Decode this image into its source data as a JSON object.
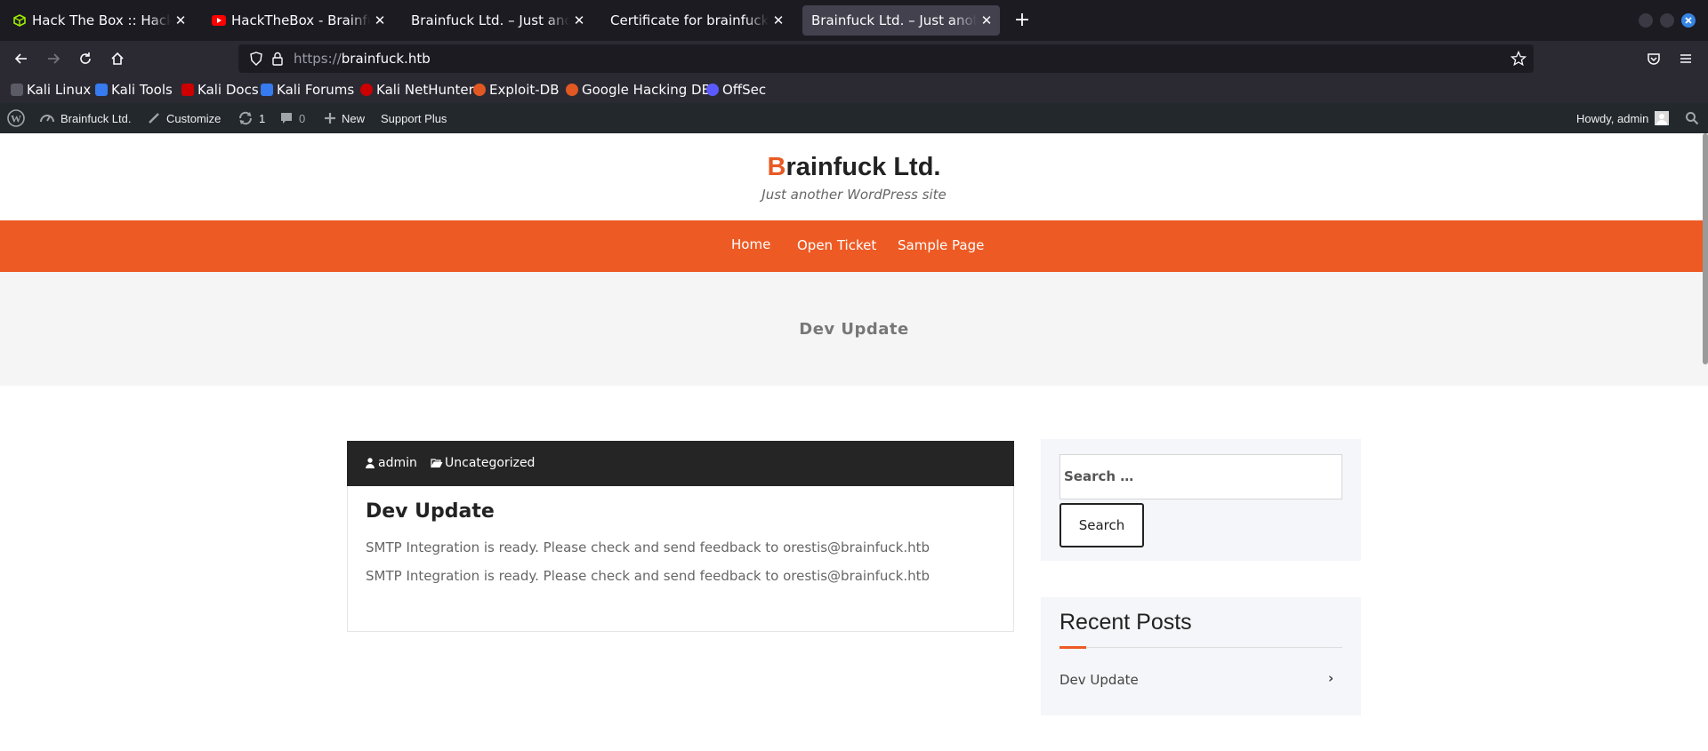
{
  "browser": {
    "tabs": [
      {
        "label": "Hack The Box :: Hack The Box",
        "icon": "htb-cube-icon",
        "active": false
      },
      {
        "label": "HackTheBox - Brainfuck - YouTube",
        "icon": "youtube-icon",
        "active": false
      },
      {
        "label": "Brainfuck Ltd. – Just another WordPress site",
        "icon": "",
        "active": false
      },
      {
        "label": "Certificate for brainfuck.htb",
        "icon": "",
        "active": false
      },
      {
        "label": "Brainfuck Ltd. – Just another WordPress site",
        "icon": "",
        "active": true
      }
    ],
    "url_protocol": "https://",
    "url_host": "brainfuck.htb",
    "bookmarks": [
      {
        "label": "Kali Linux",
        "color": "#367bf0"
      },
      {
        "label": "Kali Tools",
        "color": "#367bf0"
      },
      {
        "label": "Kali Docs",
        "color": "#cc0000"
      },
      {
        "label": "Kali Forums",
        "color": "#367bf0"
      },
      {
        "label": "Kali NetHunter",
        "color": "#cc0000"
      },
      {
        "label": "Exploit-DB",
        "color": "#e25822"
      },
      {
        "label": "Google Hacking DB",
        "color": "#e25822"
      },
      {
        "label": "OffSec",
        "color": "#5a5aff"
      }
    ]
  },
  "adminbar": {
    "site_name": "Brainfuck Ltd.",
    "customize": "Customize",
    "updates_count": "1",
    "comments_count": "0",
    "new_label": "New",
    "support": "Support Plus",
    "howdy": "Howdy, admin"
  },
  "site": {
    "title_first": "B",
    "title_rest": "rainfuck Ltd.",
    "tagline": "Just another WordPress site",
    "accent_color": "#ee5a24",
    "menu": [
      "Home",
      "Open Ticket",
      "Sample Page"
    ],
    "banner_title": "Dev Update"
  },
  "post": {
    "author": "admin",
    "category": "Uncategorized",
    "title": "Dev Update",
    "paragraphs": [
      "SMTP Integration is ready. Please check and send feedback to orestis@brainfuck.htb",
      "SMTP Integration is ready. Please check and send feedback to orestis@brainfuck.htb"
    ]
  },
  "sidebar": {
    "search_placeholder": "Search …",
    "search_button": "Search",
    "recent_title": "Recent Posts",
    "recent_items": [
      "Dev Update"
    ]
  }
}
